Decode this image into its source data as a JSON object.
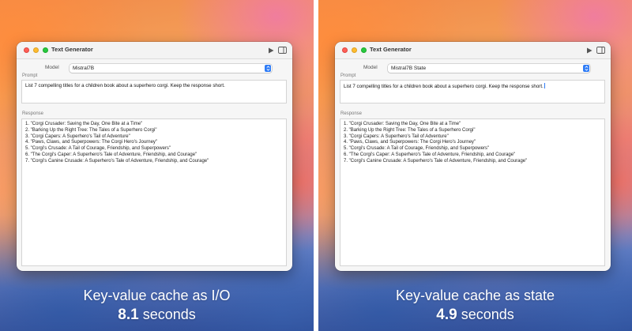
{
  "panels": [
    {
      "window": {
        "title": "Text Generator",
        "model_label": "Model",
        "model_value": "Mistral7B",
        "prompt_label": "Prompt",
        "prompt_text": "List 7 compelling titles for a children book about a superhero corgi. Keep the response short.",
        "response_label": "Response",
        "response_lines": [
          "1. \"Corgi Crusader: Saving the Day, One Bite at a Time\"",
          "2. \"Barking Up the Right Tree: The Tales of a Superhero Corgi\"",
          "3. \"Corgi Capers: A Superhero's Tail of Adventure\"",
          "4. \"Paws, Claws, and Superpowers: The Corgi Hero's Journey\"",
          "5. \"Corgi's Crusade: A Tail of Courage, Friendship, and Superpowers\"",
          "6. \"The Corgi's Caper: A Superhero's Tale of Adventure, Friendship, and Courage\"",
          "7. \"Corgi's Canine Crusade: A Superhero's Tale of Adventure, Friendship, and Courage\""
        ]
      },
      "caption": {
        "title": "Key-value cache as I/O",
        "time_value": "8.1",
        "time_unit": "seconds"
      }
    },
    {
      "window": {
        "title": "Text Generator",
        "model_label": "Model",
        "model_value": "Mistral7B State",
        "prompt_label": "Prompt",
        "prompt_text": "List 7 compelling titles for a children book about a superhero corgi. Keep the response short.",
        "response_label": "Response",
        "response_lines": [
          "1. \"Corgi Crusader: Saving the Day, One Bite at a Time\"",
          "2. \"Barking Up the Right Tree: The Tales of a Superhero Corgi\"",
          "3. \"Corgi Capers: A Superhero's Tail of Adventure\"",
          "4. \"Paws, Claws, and Superpowers: The Corgi Hero's Journey\"",
          "5. \"Corgi's Crusade: A Tail of Courage, Friendship, and Superpowers\"",
          "6. \"The Corgi's Caper: A Superhero's Tale of Adventure, Friendship, and Courage\"",
          "7. \"Corgi's Canine Crusade: A Superhero's Tale of Adventure, Friendship, and Courage\""
        ]
      },
      "caption": {
        "title": "Key-value cache as state",
        "time_value": "4.9",
        "time_unit": "seconds"
      }
    }
  ],
  "icons": [
    "close-light",
    "minimize-light",
    "zoom-light",
    "play-icon",
    "sidebar-toggle-icon",
    "chevron-updown-icon"
  ],
  "colors": {
    "accent": "#2f7cf6",
    "close": "#ff5f57",
    "minimize": "#febc2e",
    "zoom": "#28c840"
  }
}
